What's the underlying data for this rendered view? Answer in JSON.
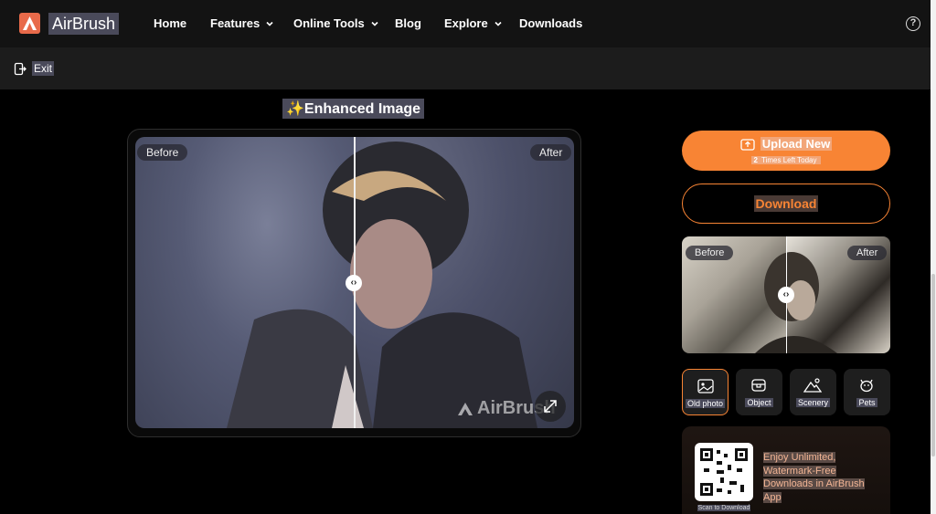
{
  "header": {
    "brand": "AirBrush",
    "nav": [
      {
        "label": "Home",
        "dropdown": false
      },
      {
        "label": "Features",
        "dropdown": true
      },
      {
        "label": "Online Tools",
        "dropdown": true
      },
      {
        "label": "Blog",
        "dropdown": false
      },
      {
        "label": "Explore",
        "dropdown": true
      },
      {
        "label": "Downloads",
        "dropdown": false
      }
    ],
    "help_icon": "question-circle-icon",
    "help_symbol": "?"
  },
  "toolbar": {
    "exit_label": "Exit"
  },
  "main": {
    "title": "✨Enhanced Image",
    "viewer": {
      "before_label": "Before",
      "after_label": "After",
      "watermark": "AirBrush",
      "handle_symbol": "‹›"
    }
  },
  "sidebar": {
    "upload": {
      "label": "Upload New",
      "sub_count": "2",
      "sub_text": " Times Left Today"
    },
    "download": {
      "label": "Download"
    },
    "preview": {
      "before_label": "Before",
      "after_label": "After",
      "handle_symbol": "‹›"
    },
    "categories": [
      {
        "label": "Old photo",
        "icon": "old-photo-icon",
        "active": true
      },
      {
        "label": "Object",
        "icon": "object-icon",
        "active": false
      },
      {
        "label": "Scenery",
        "icon": "scenery-icon",
        "active": false
      },
      {
        "label": "Pets",
        "icon": "pets-icon",
        "active": false
      }
    ],
    "promo": {
      "lines": [
        "Enjoy Unlimited,",
        "Watermark-Free",
        "Downloads in  AirBrush",
        "App"
      ],
      "qr_caption": "Scan to Download"
    }
  },
  "colors": {
    "accent": "#f88434",
    "nav_bg": "#131313",
    "subbar_bg": "#1c1c1c"
  }
}
